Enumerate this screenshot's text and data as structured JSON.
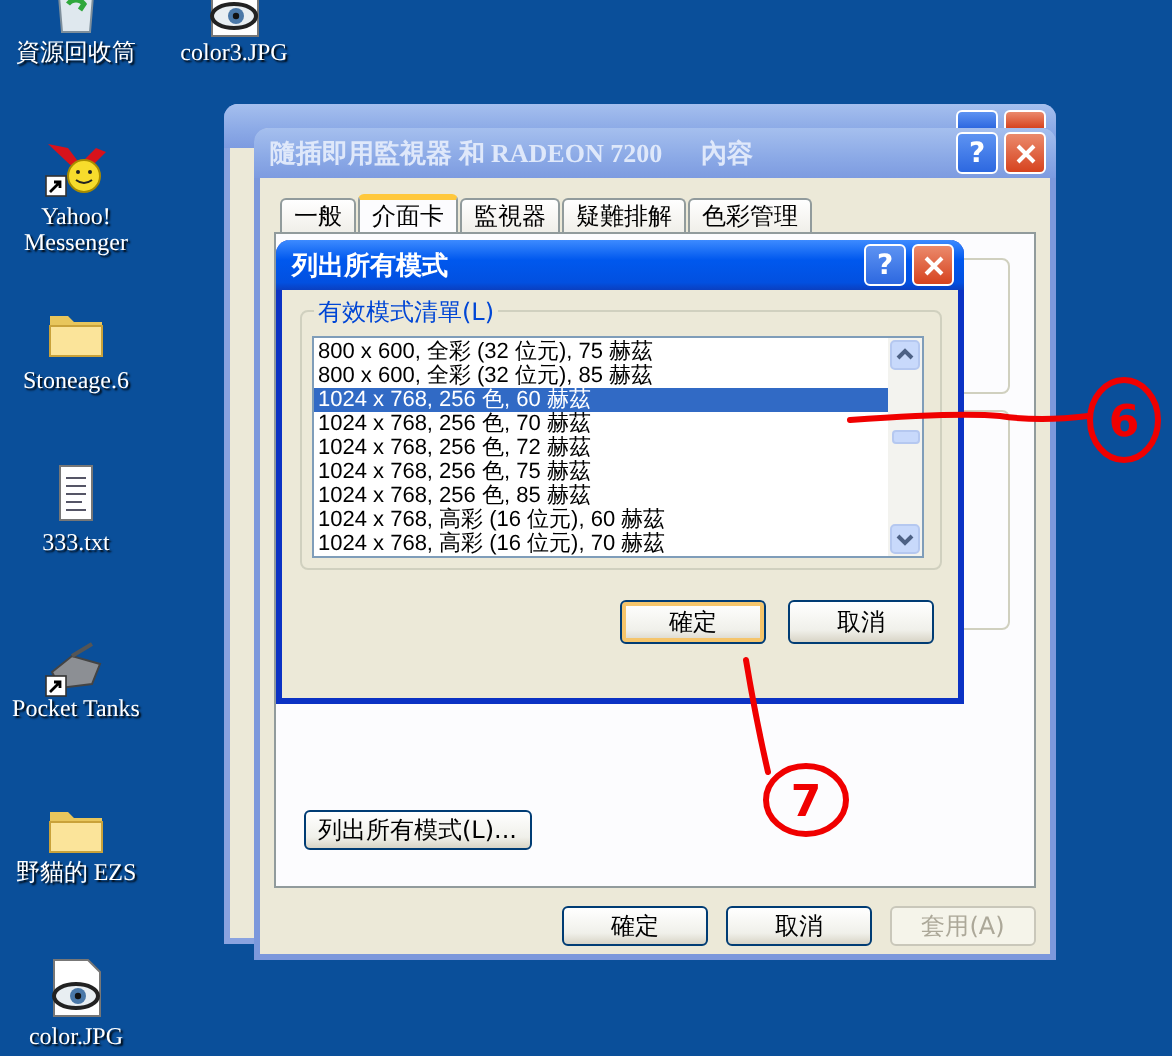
{
  "desktop_icons": [
    {
      "label": "資源回收筒",
      "kind": "recycle",
      "shortcut": false
    },
    {
      "label": "color3.JPG",
      "kind": "image",
      "shortcut": false
    },
    {
      "label": "Yahoo! Messenger",
      "kind": "yahoo",
      "shortcut": true
    },
    {
      "label": "Stoneage.6",
      "kind": "folder",
      "shortcut": false
    },
    {
      "label": "333.txt",
      "kind": "text",
      "shortcut": false
    },
    {
      "label": "Pocket Tanks",
      "kind": "game",
      "shortcut": true
    },
    {
      "label": "野貓的 EZS",
      "kind": "folder",
      "shortcut": false
    },
    {
      "label": "color.JPG",
      "kind": "image",
      "shortcut": false
    }
  ],
  "back_window": {
    "buttons": [
      {
        "kind": "help"
      },
      {
        "kind": "close"
      }
    ]
  },
  "window": {
    "title": "隨插即用監視器 和 RADEON 7200      內容",
    "help_button": "?",
    "tabs": [
      {
        "label": "一般",
        "selected": false
      },
      {
        "label": "介面卡",
        "selected": true
      },
      {
        "label": "監視器",
        "selected": false
      },
      {
        "label": "疑難排解",
        "selected": false
      },
      {
        "label": "色彩管理",
        "selected": false
      }
    ],
    "list_all_button": "列出所有模式(L)...",
    "buttons": [
      {
        "label": "確定",
        "disabled": false
      },
      {
        "label": "取消",
        "disabled": false
      },
      {
        "label": "套用(A)",
        "disabled": true
      }
    ]
  },
  "dialog": {
    "title": "列出所有模式",
    "help_button": "?",
    "group_label": "有效模式清單(L)",
    "modes": [
      {
        "label": "800 x 600, 全彩 (32 位元), 75 赫茲",
        "selected": false
      },
      {
        "label": "800 x 600, 全彩 (32 位元), 85 赫茲",
        "selected": false
      },
      {
        "label": "1024 x 768, 256 色, 60 赫茲",
        "selected": true
      },
      {
        "label": "1024 x 768, 256 色, 70 赫茲",
        "selected": false
      },
      {
        "label": "1024 x 768, 256 色, 72 赫茲",
        "selected": false
      },
      {
        "label": "1024 x 768, 256 色, 75 赫茲",
        "selected": false
      },
      {
        "label": "1024 x 768, 256 色, 85 赫茲",
        "selected": false
      },
      {
        "label": "1024 x 768, 高彩 (16 位元), 60 赫茲",
        "selected": false
      },
      {
        "label": "1024 x 768, 高彩 (16 位元), 70 赫茲",
        "selected": false
      }
    ],
    "buttons": [
      {
        "label": "確定",
        "default": true
      },
      {
        "label": "取消",
        "default": false
      }
    ]
  },
  "annotations": [
    {
      "label": "6"
    },
    {
      "label": "7"
    }
  ]
}
